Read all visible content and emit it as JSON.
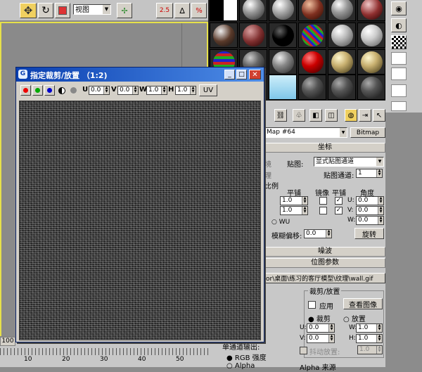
{
  "toolbar": {
    "view_select": "视图"
  },
  "window": {
    "title": "指定裁剪/放置 （1:2)"
  },
  "crop_toolbar": {
    "u_label": "U",
    "u_value": "0.0",
    "v_label": "V",
    "v_value": "0.0",
    "w_label": "W",
    "w_value": "1.0",
    "h_label": "H",
    "h_value": "1.0",
    "uv_button": "UV"
  },
  "material": {
    "map_name": "Map #64",
    "map_type": "Bitmap",
    "coordinates_header": "坐标",
    "env_label": "境",
    "mapping_label": "贴图:",
    "mapping_value": "显式贴图通道",
    "texture_label": "理",
    "map_channel_label": "贴图通道:",
    "map_channel_value": "1",
    "scale_label": "比例",
    "tiling_header": "平铺",
    "mirror_header": "镜像",
    "tile_header": "平铺",
    "angle_header": "角度",
    "tiling_u": "1.0",
    "tiling_v": "1.0",
    "angle_u_label": "U:",
    "angle_u": "0.0",
    "angle_v_label": "V:",
    "angle_v": "0.0",
    "angle_w_label": "W:",
    "angle_w": "0.0",
    "wu_label": "WU",
    "blur_offset_label": "模糊偏移:",
    "blur_offset_value": "0.0",
    "rotate_button": "旋转",
    "noise_header": "噪波",
    "bitmap_params_header": "位图参数",
    "bitmap_path": "or\\桌面\\练习的客厅模型\\纹理\\wall.gif",
    "crop_group": "裁剪/放置",
    "apply_label": "应用",
    "view_image_button": "查看图像",
    "crop_label": "裁剪",
    "place_label": "放置",
    "u_label": "U:",
    "crop_u": "0.0",
    "v_label": "V:",
    "crop_v": "0.0",
    "w_label": "W:",
    "crop_w": "1.0",
    "h_label": "H:",
    "crop_h": "1.0",
    "jitter_label": "抖动放置:",
    "jitter_value": "1.0",
    "mono_output_group": "单通道输出:",
    "rgb_intensity": "RGB 强度",
    "alpha_label": "Alpha",
    "alpha_source": "Alpha 来源"
  },
  "timeline": {
    "counter": "100",
    "ticks": [
      "10",
      "20",
      "30",
      "40",
      "50"
    ]
  }
}
